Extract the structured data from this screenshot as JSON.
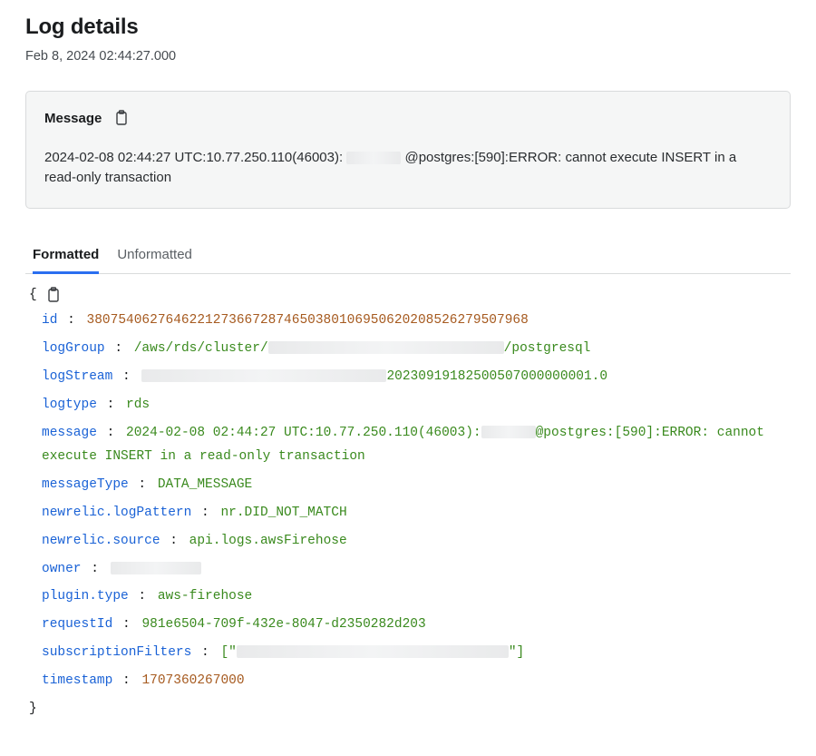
{
  "header": {
    "title": "Log details",
    "timestamp": "Feb 8, 2024 02:44:27.000"
  },
  "messageCard": {
    "label": "Message",
    "body_prefix": "2024-02-08 02:44:27 UTC:10.77.250.110(46003):",
    "body_suffix": "@postgres:[590]:ERROR:  cannot execute INSERT in a read-only transaction"
  },
  "tabs": {
    "formatted": "Formatted",
    "unformatted": "Unformatted"
  },
  "entries": {
    "id": {
      "key": "id",
      "type": "num",
      "value": "38075406276462212736672874650380106950620208526279507968"
    },
    "logGroup": {
      "key": "logGroup",
      "type": "plain",
      "prefix": "/aws/rds/cluster/",
      "suffix": "/postgresql",
      "redact_w": "w260"
    },
    "logStream": {
      "key": "logStream",
      "type": "plain",
      "prefix": "",
      "suffix": "20230919182500507000000001.0",
      "redact_w": "w270"
    },
    "logtype": {
      "key": "logtype",
      "type": "plain",
      "value": "rds"
    },
    "message": {
      "key": "message",
      "type": "plain",
      "prefix": "2024-02-08 02:44:27 UTC:10.77.250.110(46003):",
      "suffix": "@postgres:[590]:ERROR: cannot execute INSERT in a read-only transaction",
      "redact_w": "w60"
    },
    "messageType": {
      "key": "messageType",
      "type": "plain",
      "value": "DATA_MESSAGE"
    },
    "newrelic_logPattern": {
      "key": "newrelic.logPattern",
      "type": "plain",
      "value": "nr.DID_NOT_MATCH"
    },
    "newrelic_source": {
      "key": "newrelic.source",
      "type": "plain",
      "value": "api.logs.awsFirehose"
    },
    "owner": {
      "key": "owner",
      "type": "plain",
      "prefix": "",
      "suffix": "",
      "redact_w": "w100"
    },
    "plugin_type": {
      "key": "plugin.type",
      "type": "plain",
      "value": "aws-firehose"
    },
    "requestId": {
      "key": "requestId",
      "type": "plain",
      "value": "981e6504-709f-432e-8047-d2350282d203"
    },
    "subscriptionFilters": {
      "key": "subscriptionFilters",
      "type": "plain",
      "prefix": "[\"",
      "suffix": "\"]",
      "redact_w": "w300"
    },
    "timestamp": {
      "key": "timestamp",
      "type": "num",
      "value": "1707360267000"
    }
  },
  "order": [
    "id",
    "logGroup",
    "logStream",
    "logtype",
    "message",
    "messageType",
    "newrelic_logPattern",
    "newrelic_source",
    "owner",
    "plugin_type",
    "requestId",
    "subscriptionFilters",
    "timestamp"
  ]
}
